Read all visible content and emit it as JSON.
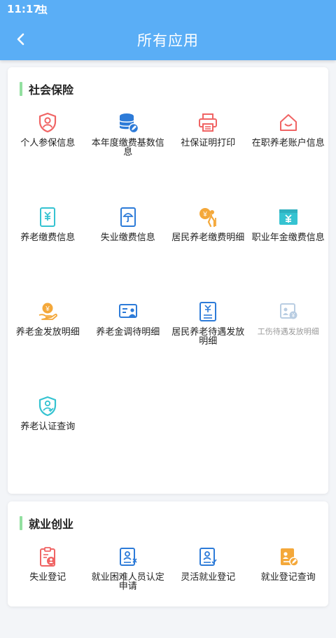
{
  "status_bar": {
    "time": "11:17",
    "app_icon": "虫"
  },
  "header": {
    "title": "所有应用"
  },
  "sections": [
    {
      "title": "社会保险",
      "items": [
        {
          "label": "个人参保信息"
        },
        {
          "label": "本年度缴费基数信息"
        },
        {
          "label": "社保证明打印"
        },
        {
          "label": "在职养老账户信息"
        },
        {
          "label": "养老缴费信息"
        },
        {
          "label": "失业缴费信息"
        },
        {
          "label": "居民养老缴费明细"
        },
        {
          "label": "职业年金缴费信息"
        },
        {
          "label": "养老金发放明细"
        },
        {
          "label": "养老金调待明细"
        },
        {
          "label": "居民养老待遇发放明细"
        },
        {
          "label": "工伤待遇发放明细"
        },
        {
          "label": "养老认证查询"
        }
      ]
    },
    {
      "title": "就业创业",
      "items": [
        {
          "label": "失业登记"
        },
        {
          "label": "就业困难人员认定申请"
        },
        {
          "label": "灵活就业登记"
        },
        {
          "label": "就业登记查询"
        }
      ]
    }
  ],
  "colors": {
    "header": "#5aaef6",
    "section_bar": "#92e0a0",
    "icon_red": "#f06464",
    "icon_blue": "#2d7bd8",
    "icon_cyan": "#35c3d1",
    "icon_orange": "#f4a83a"
  }
}
